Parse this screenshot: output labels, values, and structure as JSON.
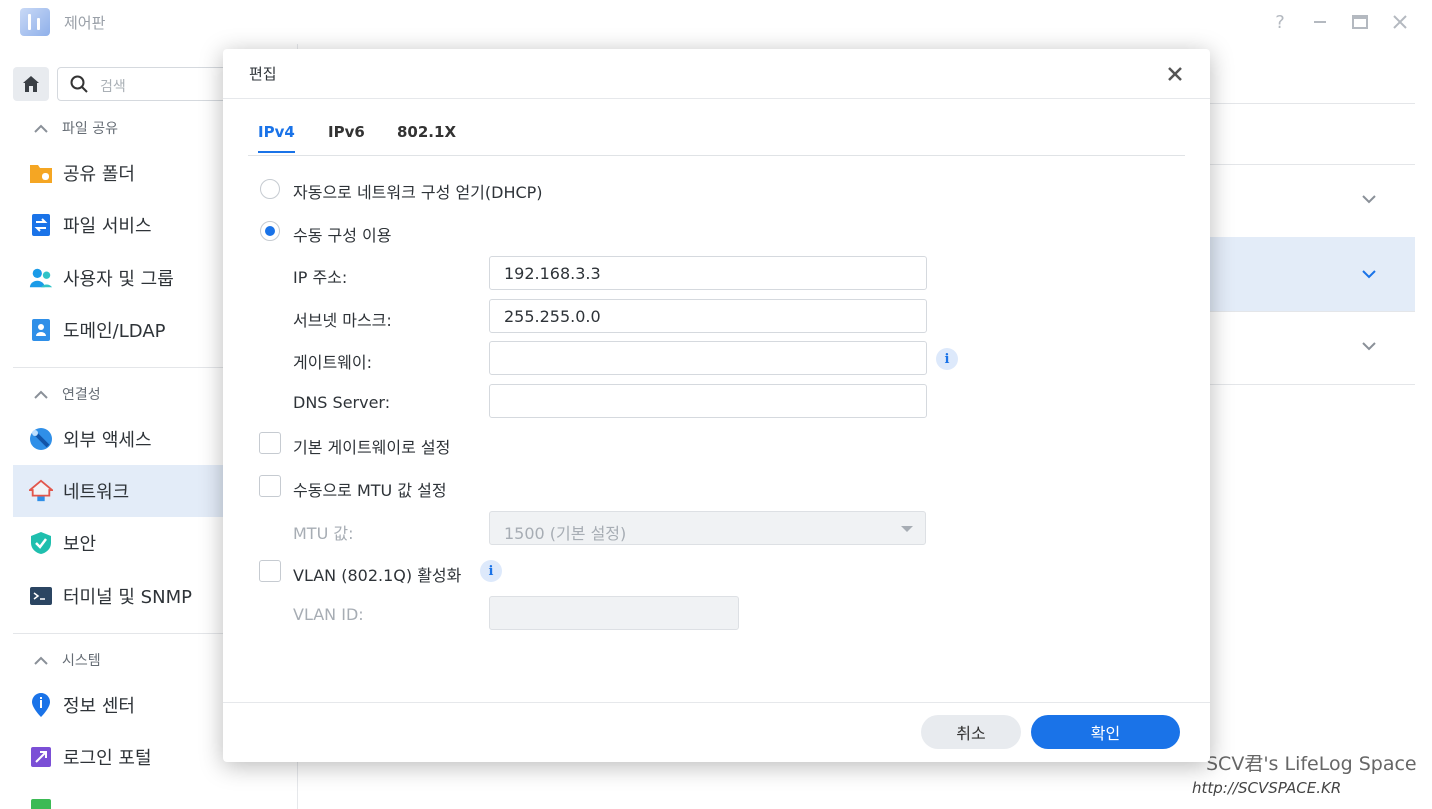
{
  "window": {
    "title": "제어판"
  },
  "sidebar": {
    "search_placeholder": "검색",
    "sections": [
      {
        "title": "파일 공유",
        "items": [
          {
            "label": "공유 폴더",
            "icon": "folder-icon"
          },
          {
            "label": "파일 서비스",
            "icon": "file-service-icon"
          },
          {
            "label": "사용자 및 그룹",
            "icon": "users-icon"
          },
          {
            "label": "도메인/LDAP",
            "icon": "domain-icon"
          }
        ]
      },
      {
        "title": "연결성",
        "items": [
          {
            "label": "외부 액세스",
            "icon": "external-access-icon"
          },
          {
            "label": "네트워크",
            "icon": "network-icon",
            "active": true
          },
          {
            "label": "보안",
            "icon": "shield-icon"
          },
          {
            "label": "터미널 및 SNMP",
            "icon": "terminal-icon"
          }
        ]
      },
      {
        "title": "시스템",
        "items": [
          {
            "label": "정보 센터",
            "icon": "info-center-icon"
          },
          {
            "label": "로그인 포털",
            "icon": "login-portal-icon"
          }
        ]
      }
    ]
  },
  "modal": {
    "title": "편집",
    "tabs": [
      "IPv4",
      "IPv6",
      "802.1X"
    ],
    "active_tab": "IPv4",
    "dhcp_label": "자동으로 네트워크 구성 얻기(DHCP)",
    "manual_label": "수동 구성 이용",
    "fields": {
      "ip": {
        "label": "IP 주소:",
        "value": "192.168.3.3"
      },
      "subnet": {
        "label": "서브넷 마스크:",
        "value": "255.255.0.0"
      },
      "gateway": {
        "label": "게이트웨이:",
        "value": ""
      },
      "dns": {
        "label": "DNS Server:",
        "value": ""
      }
    },
    "default_gateway_label": "기본 게이트웨이로 설정",
    "mtu_manual_label": "수동으로 MTU 값 설정",
    "mtu": {
      "label": "MTU 값:",
      "value": "1500 (기본 설정)"
    },
    "vlan_label": "VLAN (802.1Q) 활성화",
    "vlan_id": {
      "label": "VLAN ID:",
      "value": ""
    },
    "cancel_label": "취소",
    "ok_label": "확인"
  },
  "watermark": {
    "line1": "SCV君's LifeLog Space",
    "line2": "http://SCVSPACE.KR"
  },
  "colors": {
    "accent": "#1a73e8",
    "active_nav_bg": "#e3ecf8"
  }
}
